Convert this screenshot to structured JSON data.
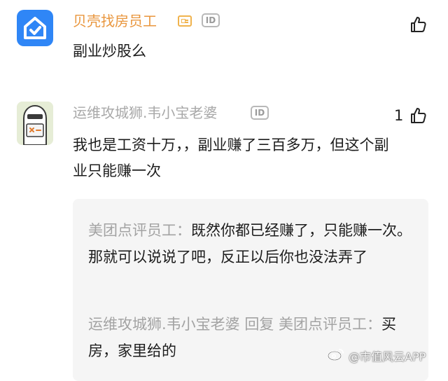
{
  "comments": [
    {
      "author": "贝壳找房员工",
      "badge_id": "ID",
      "text": "副业炒股么",
      "likes": ""
    },
    {
      "author": "运维攻城狮.韦小宝老婆",
      "badge_id": "ID",
      "text": "我也是工资十万，，副业赚了三百多万，但这个副业只能赚一次",
      "likes": "1",
      "replies": [
        {
          "author": "美团点评员工：",
          "text": "既然你都已经赚了，只能赚一次。那就可以说说了吧，反正以后你也没法弄了"
        },
        {
          "author": "运维攻城狮.韦小宝老婆 回复 美团点评员工：",
          "text": "买房，家里给的"
        }
      ]
    }
  ],
  "watermark": "@市值风云APP",
  "colors": {
    "brand_orange": "#e9963d",
    "avatar_blue": "#2f86f6",
    "muted_gray": "#a8a8a8"
  }
}
